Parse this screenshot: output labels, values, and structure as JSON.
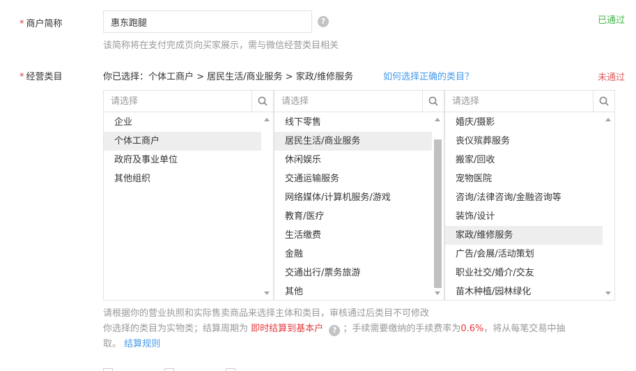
{
  "merchant_name": {
    "label": "商户简称",
    "required_mark": "*",
    "value": "惠东跑腿",
    "help_icon": "question-circle-icon",
    "hint": "该简称将在支付完成页向买家展示，需与微信经营类目相关",
    "status": "已通过"
  },
  "category": {
    "label": "经营类目",
    "required_mark": "*",
    "selected_prefix": "你已选择：",
    "selected_path": "个体工商户 > 居民生活/商业服务 > 家政/维修服务",
    "how_link": "如何选择正确的类目？",
    "status": "未通过",
    "columns": [
      {
        "placeholder": "请选择",
        "items": [
          "企业",
          "个体工商户",
          "政府及事业单位",
          "其他组织"
        ],
        "active_index": 1
      },
      {
        "placeholder": "请选择",
        "items": [
          "线下零售",
          "居民生活/商业服务",
          "休闲娱乐",
          "交通运输服务",
          "网络媒体/计算机服务/游戏",
          "教育/医疗",
          "生活缴费",
          "金融",
          "交通出行/票务旅游",
          "其他"
        ],
        "active_index": 1
      },
      {
        "placeholder": "请选择",
        "items": [
          "婚庆/摄影",
          "丧仪殡葬服务",
          "搬家/回收",
          "宠物医院",
          "咨询/法律咨询/金融咨询等",
          "装饰/设计",
          "家政/维修服务",
          "广告/会展/活动策划",
          "职业社交/婚介/交友",
          "苗木种植/园林绿化"
        ],
        "active_index": 6
      }
    ],
    "note_line1": "请根据你的营业执照和实际售卖商品来选择主体和类目，审核通过后类目不可修改",
    "note_line2_a": "你选择的类目为实物类；结算周期为",
    "note_line2_red1": "即时结算到基本户",
    "note_line2_b": "；手续需要缴纳的手续费率为",
    "note_line2_rate": "0.6%",
    "note_line2_c": "，将从每笔交易中抽",
    "note_line3_a": "取。",
    "note_line3_link": "结算规则"
  },
  "colors": {
    "pass": "#44b549",
    "fail": "#e15f63",
    "link": "#459ae9",
    "required": "#e4393c"
  }
}
